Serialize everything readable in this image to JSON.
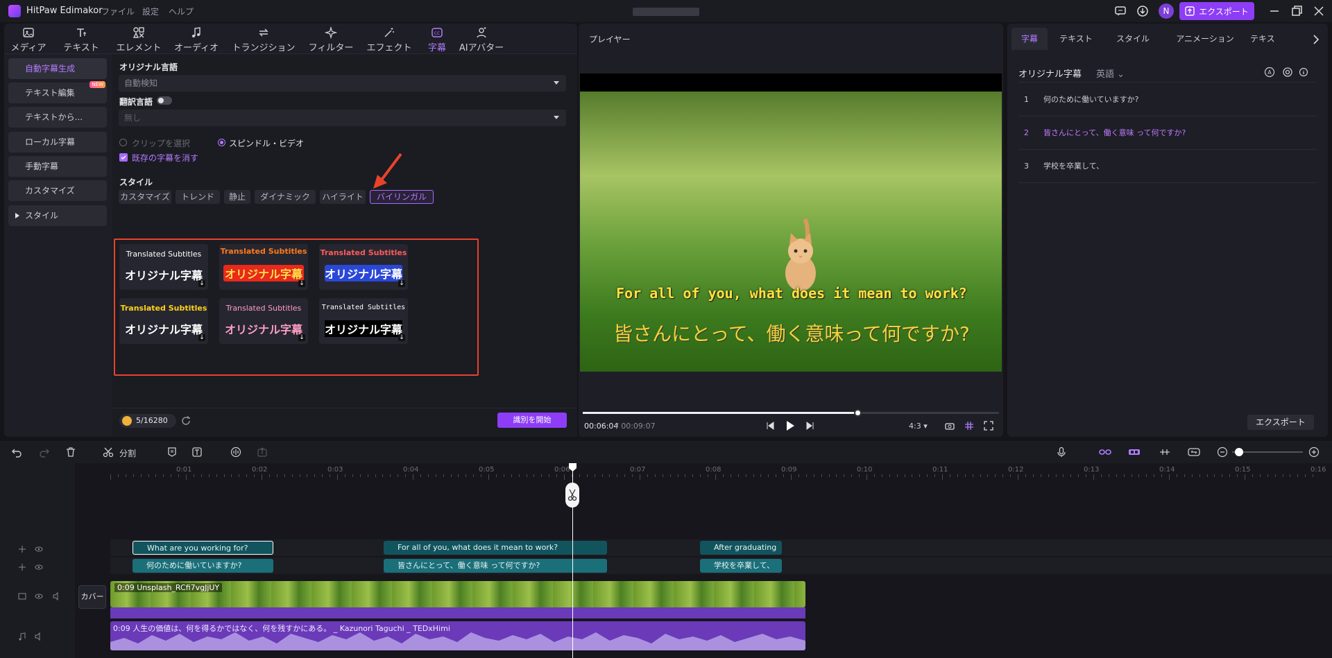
{
  "app": {
    "name": "HitPaw Edimakor",
    "menu": [
      "ファイル",
      "設定",
      "ヘルプ"
    ],
    "avatar": "N",
    "export_label": "エクスポート"
  },
  "tools": {
    "tabs": [
      "メディア",
      "テキスト",
      "エレメント",
      "オーディオ",
      "トランジション",
      "フィルター",
      "エフェクト",
      "字幕",
      "AIアバター"
    ],
    "active": "字幕"
  },
  "sidenav": {
    "items": [
      "自動字幕生成",
      "テキスト編集",
      "テキストから...",
      "ローカル字幕",
      "手動字幕",
      "カスタマイズ",
      "スタイル"
    ],
    "new_badge": "NEW"
  },
  "settings": {
    "original_lang_label": "オリジナル言語",
    "original_lang_value": "自動検知",
    "translate_label": "翻訳言語",
    "translate_value": "無し",
    "radio_clip": "クリップを選択",
    "radio_whole": "スピンドル・ビデオ",
    "clear_existing": "既存の字幕を消す",
    "style_label": "スタイル",
    "style_chips": [
      "カスタマイズ",
      "トレンド",
      "静止",
      "ダイナミック",
      "ハイライト",
      "バイリンガル"
    ],
    "presets": [
      {
        "top": "Translated Subtitles",
        "bottom": "オリジナル字幕"
      },
      {
        "top": "Translated Subtitles",
        "bottom": "オリジナル字幕"
      },
      {
        "top": "Translated Subtitles",
        "bottom": "オリジナル字幕"
      },
      {
        "top": "Translated Subtitles",
        "bottom": "オリジナル字幕"
      },
      {
        "top": "Translated Subtitles",
        "bottom": "オリジナル字幕"
      },
      {
        "top": "Translated Subtitles",
        "bottom": "オリジナル字幕"
      }
    ],
    "credits": "5/16280",
    "start_label": "識別を開始"
  },
  "player": {
    "title": "プレイヤー",
    "subtitle_en": "For all of you, what does it mean to work?",
    "subtitle_ja": "皆さんにとって、働く意味って何ですか?",
    "time_current": "00:06:04",
    "time_total": "/ 00:09:07",
    "progress": 0.66,
    "ratio": "4:3"
  },
  "right": {
    "tabs": [
      "字幕",
      "テキスト",
      "スタイル",
      "アニメーション",
      "テキス"
    ],
    "heading": "オリジナル字幕",
    "lang": "英語",
    "rows": [
      {
        "num": "1",
        "text": "何のために働いていますか?"
      },
      {
        "num": "2",
        "text": "皆さんにとって、働く意味 って何ですか?"
      },
      {
        "num": "3",
        "text": "学校を卒業して、"
      }
    ],
    "export_label": "エクスポート"
  },
  "timeline": {
    "split_label": "分割",
    "ruler": [
      "0:01",
      "0:02",
      "0:03",
      "0:04",
      "0:05",
      "0:06",
      "0:07",
      "0:08",
      "0:09",
      "0:10",
      "0:11",
      "0:12",
      "0:13",
      "0:14",
      "0:15",
      "0:16"
    ],
    "en_clips": [
      "What are you working for?",
      "For all of you, what does it mean to work?",
      "After graduating"
    ],
    "ja_clips": [
      "何のために働いていますか?",
      "皆さんにとって、働く意味 って何ですか?",
      "学校を卒業して、"
    ],
    "video_label": "0:09  Unsplash_RCfi7vgJjUY",
    "audio_label": "0:09  人生の価値は、何を得るかではなく、何を残すかにある。 _ Kazunori Taguchi _ TEDxHimi",
    "cover_label": "カバー"
  }
}
